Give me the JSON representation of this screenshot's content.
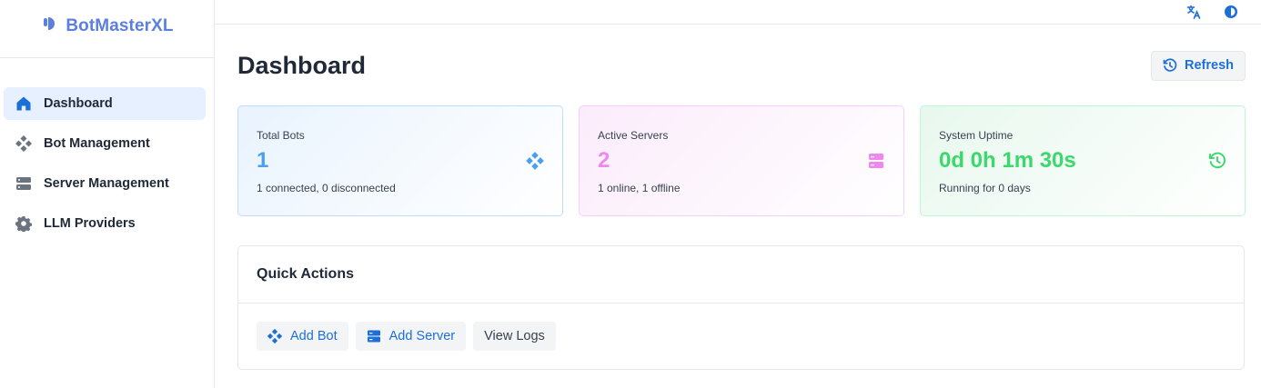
{
  "brand": {
    "name": "BotMasterXL",
    "icon": "brand-logo-icon",
    "color": "#5b7fe0"
  },
  "sidebar": {
    "items": [
      {
        "label": "Dashboard",
        "icon": "home-icon",
        "active": true
      },
      {
        "label": "Bot Management",
        "icon": "bot-grid-icon",
        "active": false
      },
      {
        "label": "Server Management",
        "icon": "server-icon",
        "active": false
      },
      {
        "label": "LLM Providers",
        "icon": "gear-icon",
        "active": false
      }
    ]
  },
  "topbar": {
    "icons": [
      "translate-icon",
      "theme-toggle-icon"
    ]
  },
  "page": {
    "title": "Dashboard",
    "refresh_label": "Refresh"
  },
  "stats": [
    {
      "label": "Total Bots",
      "value": "1",
      "sub": "1 connected, 0 disconnected",
      "icon": "bot-grid-icon",
      "color": "#4aa0f0"
    },
    {
      "label": "Active Servers",
      "value": "2",
      "sub": "1 online, 1 offline",
      "icon": "server-icon",
      "color": "#ee88ee"
    },
    {
      "label": "System Uptime",
      "value": "0d 0h 1m 30s",
      "sub": "Running for 0 days",
      "icon": "clock-icon",
      "color": "#3ad96c"
    }
  ],
  "quick_actions": {
    "title": "Quick Actions",
    "buttons": [
      {
        "label": "Add Bot",
        "icon": "bot-grid-icon"
      },
      {
        "label": "Add Server",
        "icon": "server-icon"
      },
      {
        "label": "View Logs"
      }
    ]
  },
  "colors": {
    "accent": "#1d6fd8",
    "active_nav_bg": "#e6f0ff"
  }
}
